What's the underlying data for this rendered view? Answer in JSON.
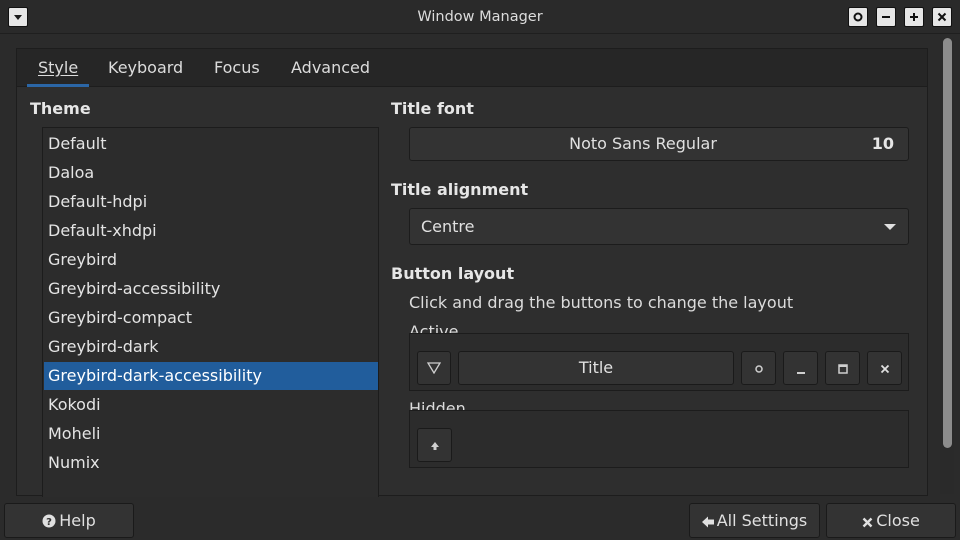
{
  "window": {
    "title": "Window Manager"
  },
  "tabs": [
    {
      "label": "Style"
    },
    {
      "label": "Keyboard"
    },
    {
      "label": "Focus"
    },
    {
      "label": "Advanced"
    }
  ],
  "theme": {
    "label": "Theme",
    "selected": "Greybird-dark-accessibility",
    "items": [
      "Default",
      "Daloa",
      "Default-hdpi",
      "Default-xhdpi",
      "Greybird",
      "Greybird-accessibility",
      "Greybird-compact",
      "Greybird-dark",
      "Greybird-dark-accessibility",
      "Kokodi",
      "Moheli",
      "Numix"
    ]
  },
  "title_font": {
    "label": "Title font",
    "font_name": "Noto Sans Regular",
    "font_size": "10"
  },
  "title_alignment": {
    "label": "Title alignment",
    "value": "Centre"
  },
  "button_layout": {
    "label": "Button layout",
    "hint": "Click and drag the buttons to change the layout",
    "active_label": "Active",
    "title_button": "Title",
    "hidden_label": "Hidden"
  },
  "footer": {
    "help": "Help",
    "all_settings": "All Settings",
    "close": "Close"
  },
  "colors": {
    "accent": "#215d9c",
    "background": "#2b2b2b"
  }
}
